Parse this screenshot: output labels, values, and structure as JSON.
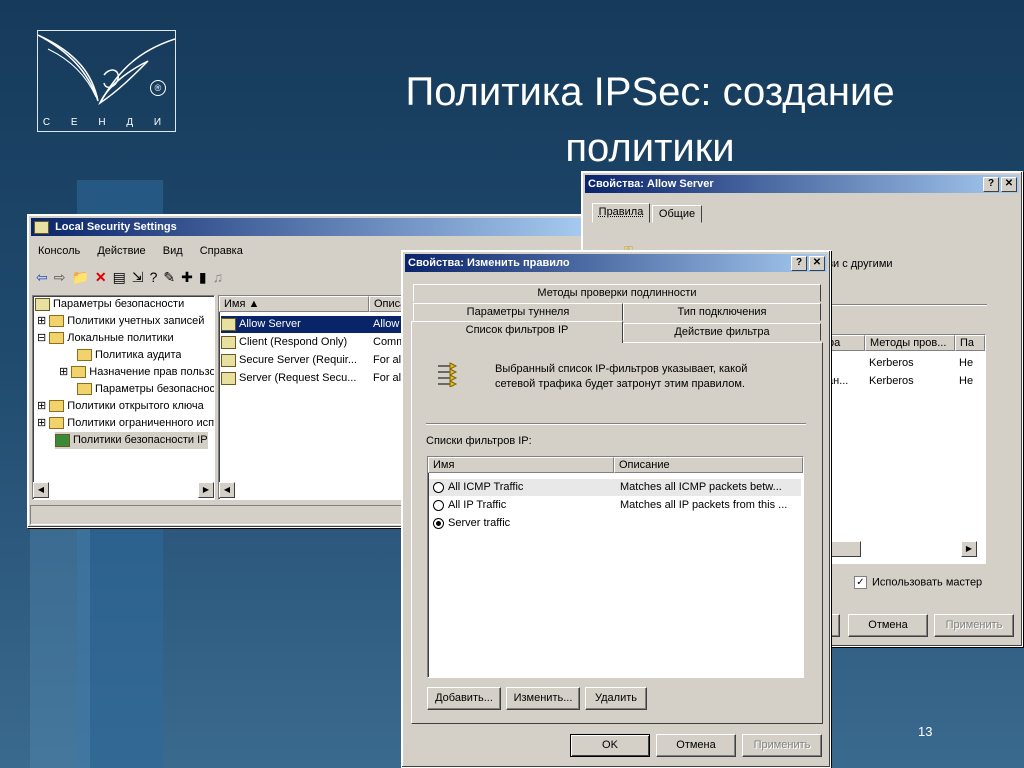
{
  "slide": {
    "title_line1": "Политика IPSec: создание",
    "title_line2": "политики",
    "page_number": "13",
    "logo_text": "С Е Н Д И",
    "logo_reg": "®"
  },
  "lss": {
    "title": "Local Security Settings",
    "menu": [
      "Консоль",
      "Действие",
      "Вид",
      "Справка"
    ],
    "tree": [
      "Параметры безопасности",
      "Политики учетных записей",
      "Локальные политики",
      "Политика аудита",
      "Назначение прав пользователей",
      "Параметры безопасности",
      "Политики открытого ключа",
      "Политики ограниченного использования",
      "Политики безопасности IP"
    ],
    "list_headers": [
      "Имя",
      "Описа"
    ],
    "list_rows": [
      {
        "name": "Allow Server",
        "desc": "Allow"
      },
      {
        "name": "Client (Respond Only)",
        "desc": "Comm"
      },
      {
        "name": "Secure Server (Requir...",
        "desc": "For al"
      },
      {
        "name": "Server (Request Secu...",
        "desc": "For al"
      }
    ]
  },
  "allow": {
    "title": "Свойства: Allow Server",
    "tabs": [
      "Правила",
      "Общие"
    ],
    "partial_text": "язи с другими",
    "headers": [
      "ра",
      "Методы пров...",
      "Па"
    ],
    "rows": [
      {
        "a": "",
        "b": "Kerberos",
        "c": "Не"
      },
      {
        "a": "ан...",
        "b": "Kerberos",
        "c": "Не"
      }
    ],
    "checkbox_label": "Использовать мастер",
    "cancel": "Отмена",
    "apply": "Применить"
  },
  "rule": {
    "title": "Свойства: Изменить правило",
    "tabs_row1": [
      "Методы проверки подлинности"
    ],
    "tabs_row2": [
      "Параметры туннеля",
      "Тип подключения"
    ],
    "tabs_row3": [
      "Список фильтров IP",
      "Действие фильтра"
    ],
    "description": "Выбранный список IP-фильтров указывает, какой сетевой трафика будет затронут этим правилом.",
    "list_label": "Списки фильтров IP:",
    "headers": [
      "Имя",
      "Описание"
    ],
    "rows": [
      {
        "name": "All ICMP Traffic",
        "desc": "Matches all ICMP packets betw..."
      },
      {
        "name": "All IP Traffic",
        "desc": "Matches all IP packets from this ..."
      },
      {
        "name": "Server traffic",
        "desc": ""
      }
    ],
    "add": "Добавить...",
    "edit": "Изменить...",
    "remove": "Удалить",
    "ok": "OK",
    "cancel": "Отмена",
    "apply": "Применить"
  }
}
